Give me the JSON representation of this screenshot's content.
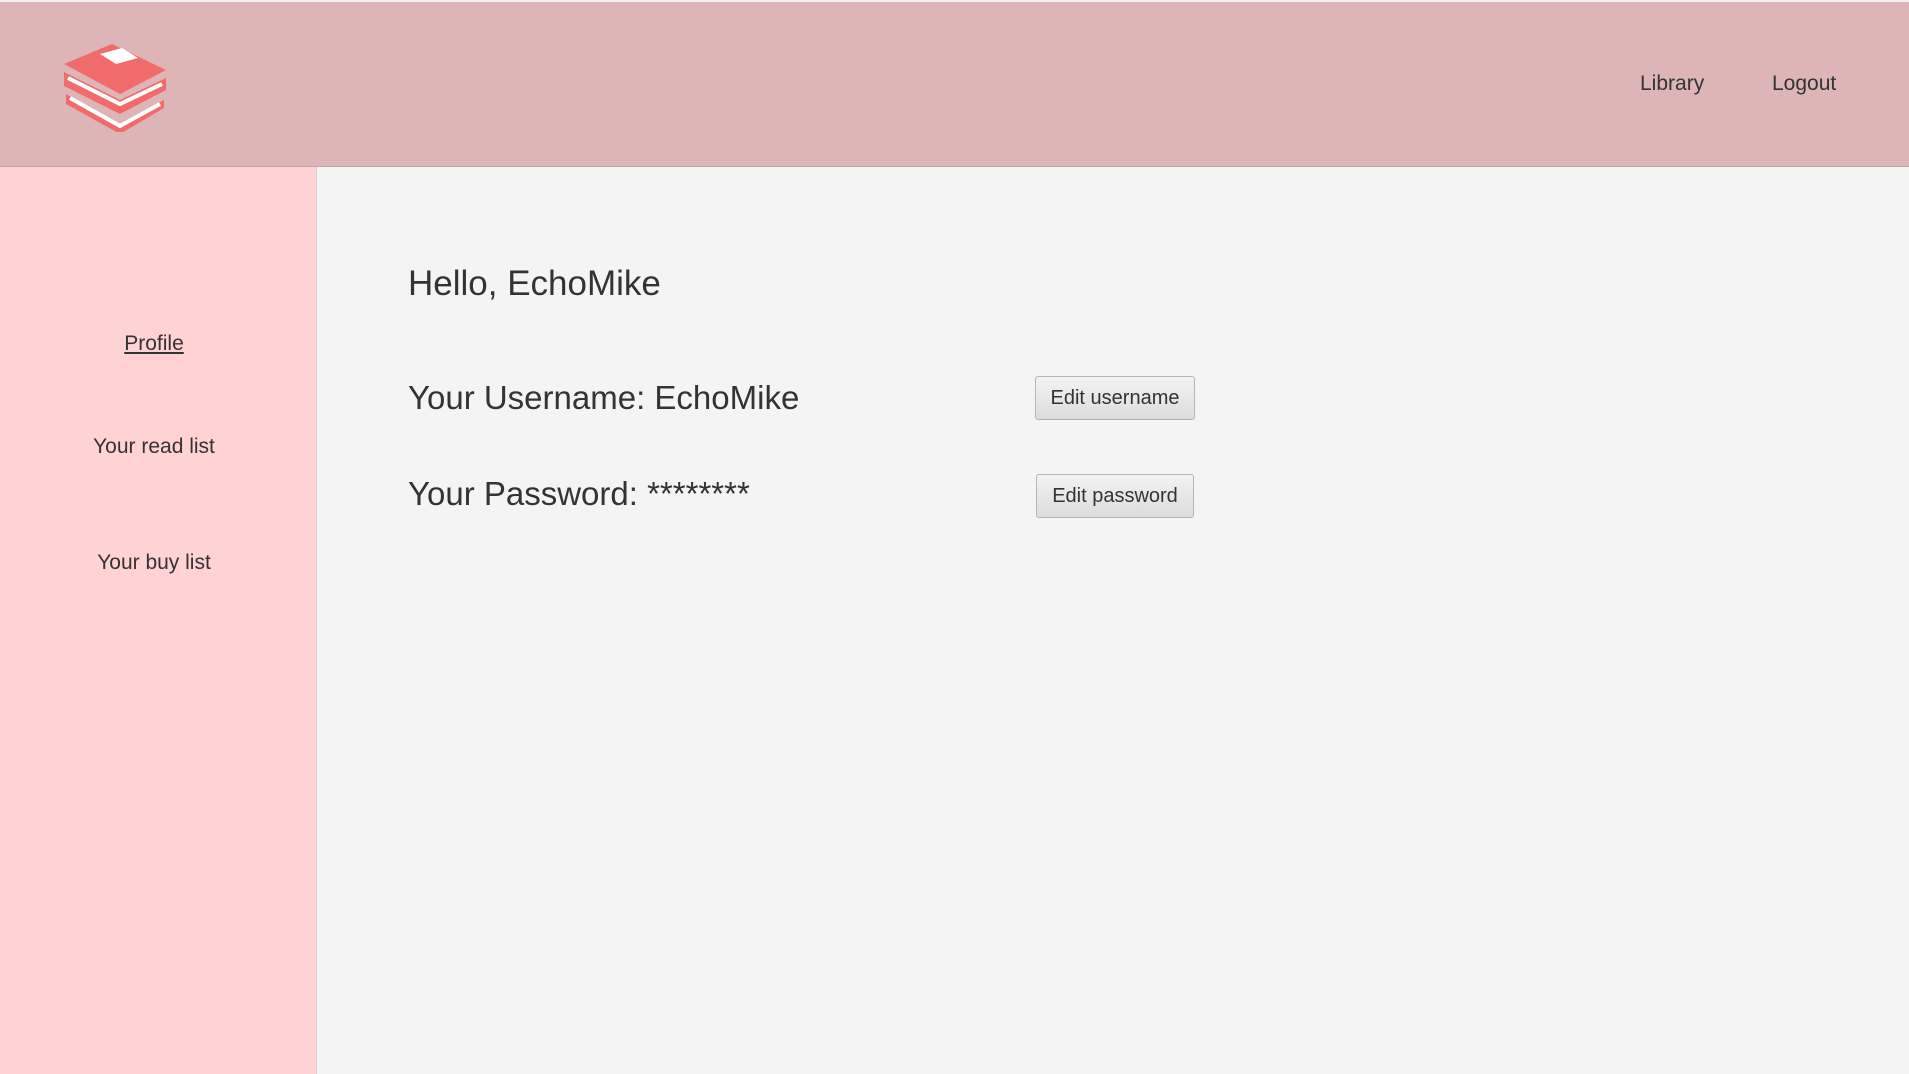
{
  "header": {
    "logo_icon": "stacked-books-icon",
    "accent_color": "#f26b6b",
    "nav": {
      "library": "Library",
      "logout": "Logout"
    }
  },
  "sidebar": {
    "items": [
      {
        "label": "Profile",
        "active": true
      },
      {
        "label": "Your read list",
        "active": false
      },
      {
        "label": "Your buy list",
        "active": false
      }
    ]
  },
  "main": {
    "greeting": "Hello, EchoMike",
    "username_label": "Your Username: EchoMike",
    "password_label": "Your Password: ********",
    "edit_username_label": "Edit username",
    "edit_password_label": "Edit password"
  },
  "colors": {
    "header_bg": "#ddb5b6",
    "sidebar_bg": "#ffd2d3",
    "main_bg": "#f4f4f4"
  }
}
